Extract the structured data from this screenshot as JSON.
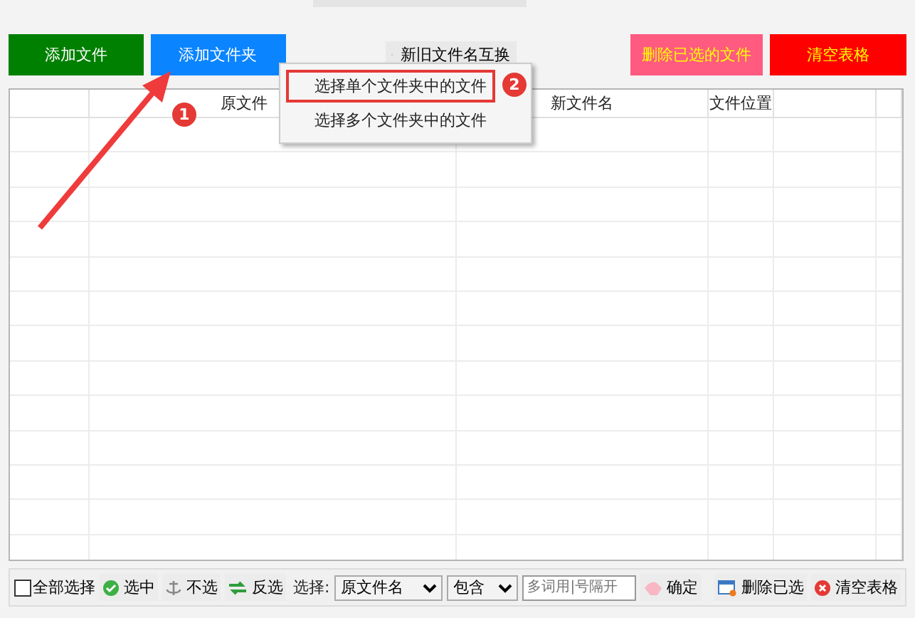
{
  "top_buttons": [
    {
      "label": "添加文件",
      "kind": "add",
      "color": "#008000"
    },
    {
      "label": "添加文件夹",
      "kind": "add",
      "color": "#0a84ff"
    },
    {
      "label": "删除已选的文件",
      "kind": "remove",
      "color": "#ff5a80"
    },
    {
      "label": "清空表格",
      "kind": "remove",
      "color": "#ff0000"
    }
  ],
  "swap_button": {
    "label": "新旧文件名互换"
  },
  "context_menu": [
    {
      "label": "选择单个文件夹中的文件",
      "selected": true
    },
    {
      "label": "选择多个文件夹中的文件",
      "selected": false
    }
  ],
  "table": {
    "columns": [
      "原文件",
      "新文件名",
      "文件位置"
    ]
  },
  "annotations": [
    {
      "label": "1"
    },
    {
      "label": "2"
    }
  ],
  "toolbar": {
    "select_all": {
      "label": "全部选择",
      "checked": false
    },
    "actions": [
      {
        "label": "选中",
        "kind": "check"
      },
      {
        "label": "不选",
        "kind": "anchor"
      },
      {
        "label": "反选",
        "kind": "swap"
      }
    ],
    "filter_label": "选择:",
    "dropdowns": [
      "原文件名",
      "包含"
    ],
    "search": {
      "placeholder": "多词用|号隔开"
    },
    "confirm": {
      "label": "确定"
    },
    "buttons": [
      {
        "label": "删除已选",
        "kind": "delete"
      },
      {
        "label": "清空表格",
        "kind": "clear"
      }
    ]
  }
}
